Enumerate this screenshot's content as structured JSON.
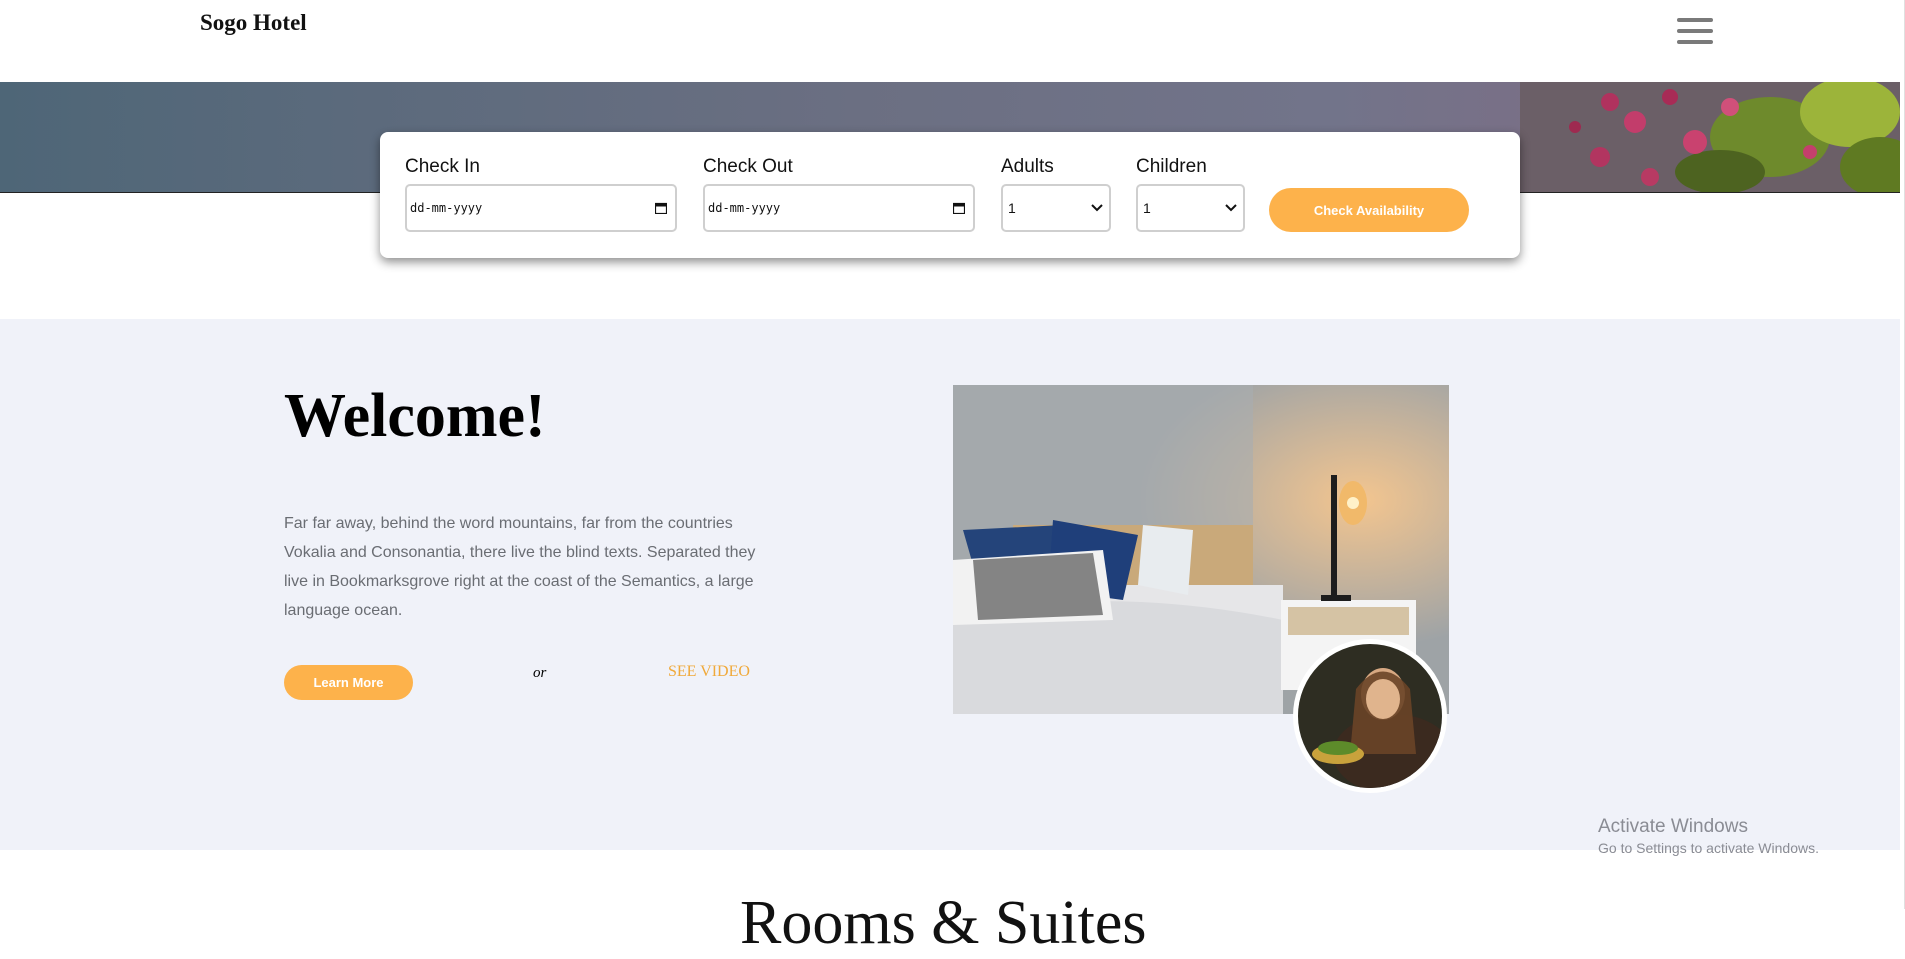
{
  "header": {
    "brand": "Sogo Hotel",
    "menu_icon": "hamburger-icon"
  },
  "booking": {
    "check_in_label": "Check In",
    "check_in_value": "dd-mm-yyyy",
    "check_out_label": "Check Out",
    "check_out_value": "dd-mm-yyyy",
    "adults_label": "Adults",
    "adults_value": "1",
    "children_label": "Children",
    "children_value": "1",
    "button_label": "Check Availability"
  },
  "welcome": {
    "title": "Welcome!",
    "text": "Far far away, behind the word mountains, far from the countries Vokalia and Consonantia, there live the blind texts. Separated they live in Bookmarksgrove right at the coast of the Semantics, a large language ocean.",
    "learn_more": "Learn More",
    "or": "or",
    "see_video": "SEE VIDEO"
  },
  "watermark": {
    "line1": "Activate Windows",
    "line2": "Go to Settings to activate Windows."
  },
  "next_section": {
    "heading": "Rooms & Suites"
  },
  "colors": {
    "accent": "#fdb24b",
    "section_bg": "#f0f2f9",
    "link": "#f0a93a"
  }
}
